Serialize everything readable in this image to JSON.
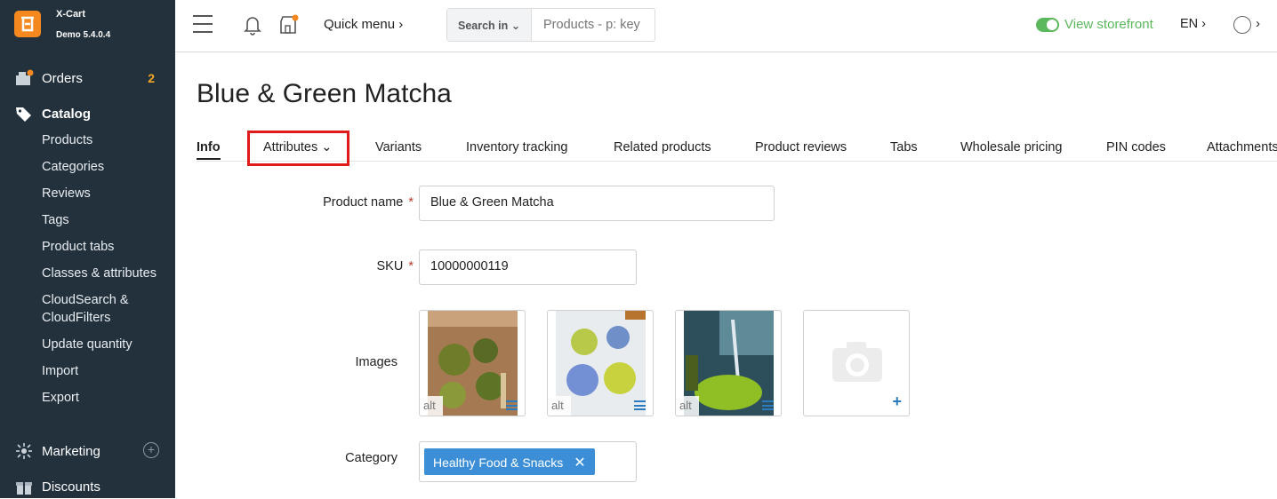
{
  "brand": {
    "name": "X-Cart",
    "version": "Demo 5.4.0.4"
  },
  "sidebar": {
    "orders": {
      "label": "Orders",
      "badge": "2"
    },
    "catalog": {
      "label": "Catalog"
    },
    "catalog_items": [
      "Products",
      "Categories",
      "Reviews",
      "Tags",
      "Product tabs",
      "Classes & attributes",
      "CloudSearch &",
      "CloudFilters",
      "Update quantity",
      "Import",
      "Export"
    ],
    "marketing": {
      "label": "Marketing"
    },
    "discounts": {
      "label": "Discounts"
    }
  },
  "topbar": {
    "quick_menu": "Quick menu ›",
    "search_in": "Search in ⌄",
    "search_placeholder": "Products - p: key",
    "view_storefront": "View storefront",
    "language": "EN ›",
    "user_chevron": "›"
  },
  "page": {
    "title": "Blue & Green Matcha",
    "tabs": [
      "Info",
      "Attributes ⌄",
      "Variants",
      "Inventory tracking",
      "Related products",
      "Product reviews",
      "Tabs",
      "Wholesale pricing",
      "PIN codes",
      "Attachments"
    ]
  },
  "form": {
    "product_name_label": "Product name",
    "product_name_value": "Blue & Green Matcha",
    "sku_label": "SKU",
    "sku_value": "10000000119",
    "required_mark": "*",
    "images_label": "Images",
    "alt_text": "alt",
    "add_image": "+",
    "category_label": "Category",
    "category_chip": "Healthy Food & Snacks",
    "chip_remove": "✕"
  },
  "colors": {
    "accent": "#3c8fd6",
    "storefront": "#5cb85c",
    "sidebar": "#23313d",
    "highlight": "#e01b1b",
    "brand": "#f5881f"
  }
}
